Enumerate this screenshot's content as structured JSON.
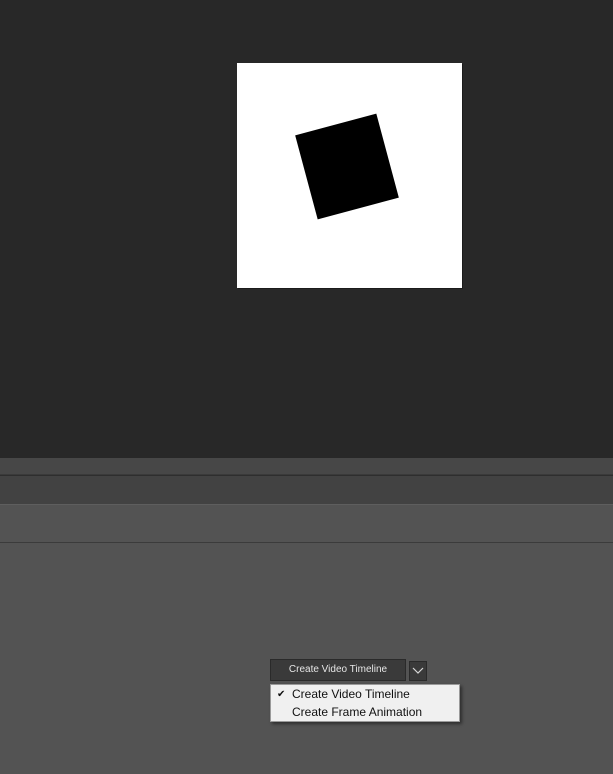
{
  "timeline": {
    "create_button_label": "Create Video Timeline",
    "dropdown_icon": "chevron-down-icon"
  },
  "dropdown_menu": {
    "items": [
      {
        "label": "Create Video Timeline",
        "checked": true,
        "check_glyph": "✔"
      },
      {
        "label": "Create Frame Animation",
        "checked": false
      }
    ]
  },
  "colors": {
    "workspace_bg": "#282828",
    "canvas_bg": "#ffffff",
    "shape_fill": "#000000",
    "panel_bg": "#535353",
    "menu_bg": "#f0f0f0"
  }
}
